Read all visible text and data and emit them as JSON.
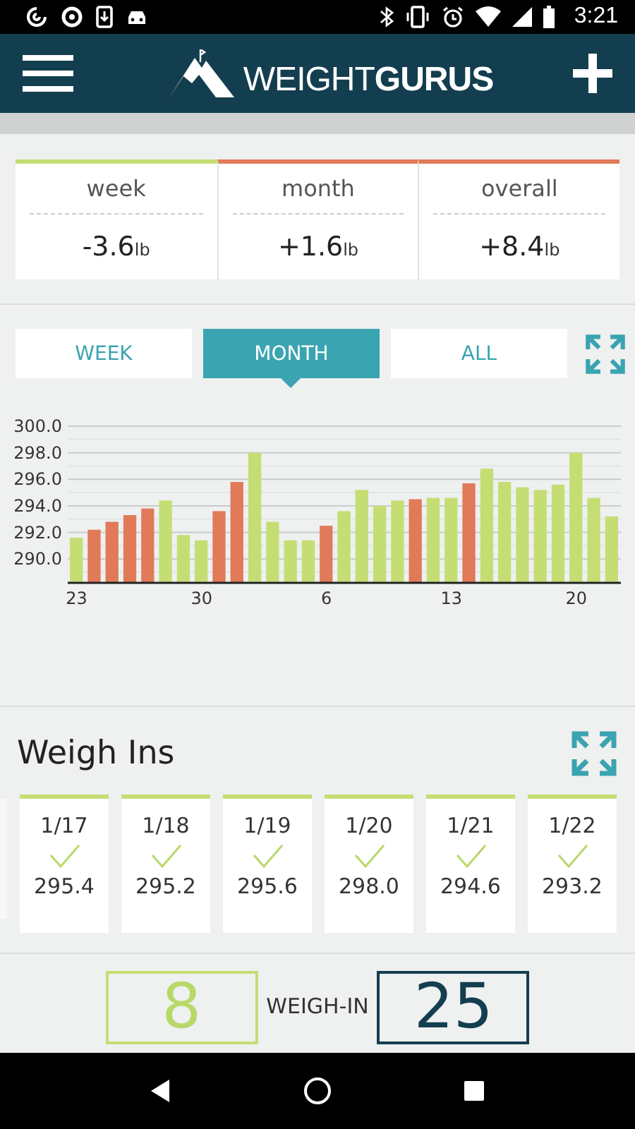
{
  "status_bar": {
    "time": "3:21"
  },
  "header": {
    "logo": "WEIGHT**GURUS**"
  },
  "stats": [
    {
      "label": "week",
      "value": "-3.6",
      "unit": "lb",
      "color": "#c4de74"
    },
    {
      "label": "month",
      "value": "+1.6",
      "unit": "lb",
      "color": "#e07a58"
    },
    {
      "label": "overall",
      "value": "+8.4",
      "unit": "lb",
      "color": "#e07a58"
    }
  ],
  "range_tabs": [
    {
      "label": "WEEK",
      "selected": false
    },
    {
      "label": "MONTH",
      "selected": true
    },
    {
      "label": "ALL",
      "selected": false
    }
  ],
  "chart_data": {
    "type": "bar",
    "grid": true,
    "categories": [
      "23",
      null,
      null,
      null,
      null,
      null,
      null,
      "30",
      null,
      null,
      null,
      null,
      null,
      null,
      "6",
      null,
      null,
      null,
      null,
      null,
      null,
      "13",
      null,
      null,
      null,
      null,
      null,
      null,
      "20",
      null,
      null
    ],
    "ylim": [
      288.2,
      300
    ],
    "yticks": [
      {
        "value": 290,
        "label": "290.0"
      },
      {
        "value": 292,
        "label": "292.0"
      },
      {
        "value": 294,
        "label": "294.0"
      },
      {
        "value": 296,
        "label": "296.0"
      },
      {
        "value": 298,
        "label": "298.0"
      },
      {
        "value": 300,
        "label": "300.0"
      }
    ],
    "series": [
      {
        "color": "#e07a58",
        "values": [
          null,
          292.2,
          292.8,
          293.3,
          293.8,
          null,
          null,
          null,
          293.6,
          295.8,
          null,
          null,
          null,
          null,
          292.5,
          null,
          null,
          null,
          null,
          294.5,
          null,
          null,
          295.7,
          null,
          null,
          null,
          null,
          null,
          null,
          null,
          null
        ]
      },
      {
        "color": "#c4de74",
        "values": [
          291.6,
          null,
          null,
          null,
          null,
          294.4,
          291.8,
          291.4,
          null,
          null,
          298.0,
          292.8,
          291.4,
          291.4,
          null,
          293.6,
          295.2,
          294.0,
          294.4,
          null,
          294.6,
          294.6,
          null,
          296.8,
          295.8,
          295.4,
          295.2,
          295.6,
          298.0,
          294.6,
          293.2
        ]
      }
    ]
  },
  "weigh_ins": {
    "title": "Weigh Ins",
    "entries": [
      {
        "date": "1/17",
        "checked": true,
        "weight": "295.4"
      },
      {
        "date": "1/18",
        "checked": true,
        "weight": "295.2"
      },
      {
        "date": "1/19",
        "checked": true,
        "weight": "295.6"
      },
      {
        "date": "1/20",
        "checked": true,
        "weight": "298.0"
      },
      {
        "date": "1/21",
        "checked": true,
        "weight": "294.6"
      },
      {
        "date": "1/22",
        "checked": true,
        "weight": "293.2"
      }
    ]
  },
  "streak": {
    "current": "8",
    "label": "WEIGH-IN",
    "best": "25"
  }
}
